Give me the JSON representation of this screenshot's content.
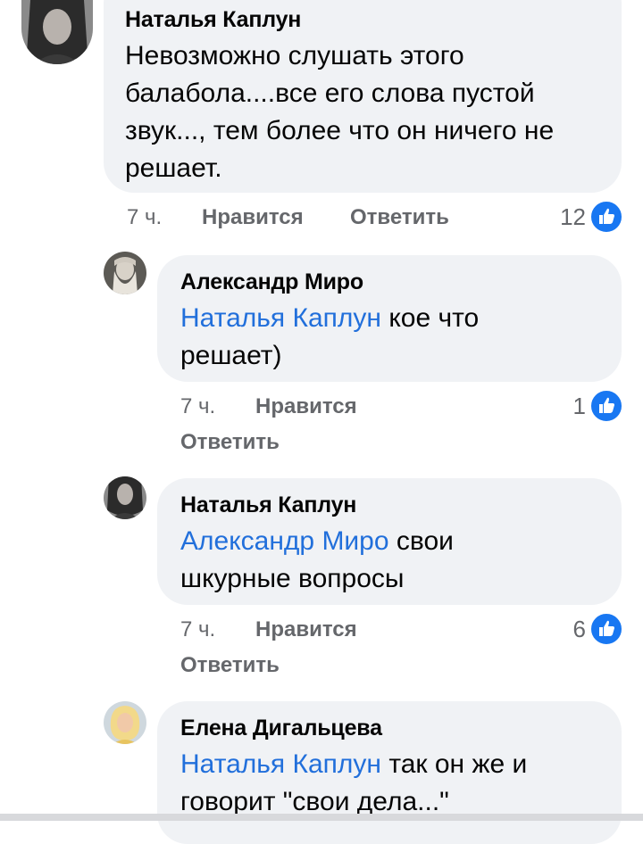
{
  "comments": [
    {
      "author": "Наталья Каплун",
      "mention": "",
      "text_lines": [
        "Невозможно слушать этого",
        "балабола....все его слова пустой",
        "звук..., тем более что он ничего не",
        "решает."
      ],
      "time": "7 ч.",
      "like_label": "Нравится",
      "reply_label": "Ответить",
      "likes": "12",
      "avatar_icon": "woman-portrait-avatar"
    },
    {
      "author": "Александр Миро",
      "mention": "Наталья Каплун",
      "text_line1_rest": " кое что",
      "text_line2": "решает)",
      "time": "7 ч.",
      "like_label": "Нравится",
      "reply_label": "Ответить",
      "likes": "1",
      "avatar_icon": "bearded-man-avatar"
    },
    {
      "author": "Наталья Каплун",
      "mention": "Александр Миро",
      "text_line1_rest": " свои",
      "text_line2": "шкурные вопросы",
      "time": "7 ч.",
      "like_label": "Нравится",
      "reply_label": "Ответить",
      "likes": "6",
      "avatar_icon": "woman-portrait-avatar"
    },
    {
      "author": "Елена Дигальцева",
      "mention": "Наталья Каплун",
      "text_line1_rest": " так он же и",
      "text_line2": "говорит \"свои дела...\"",
      "avatar_icon": "blonde-woman-avatar"
    }
  ],
  "colors": {
    "bubble": "#f0f2f5",
    "mention": "#216fdb",
    "meta": "#65676b",
    "like_badge": "#1877f2"
  }
}
